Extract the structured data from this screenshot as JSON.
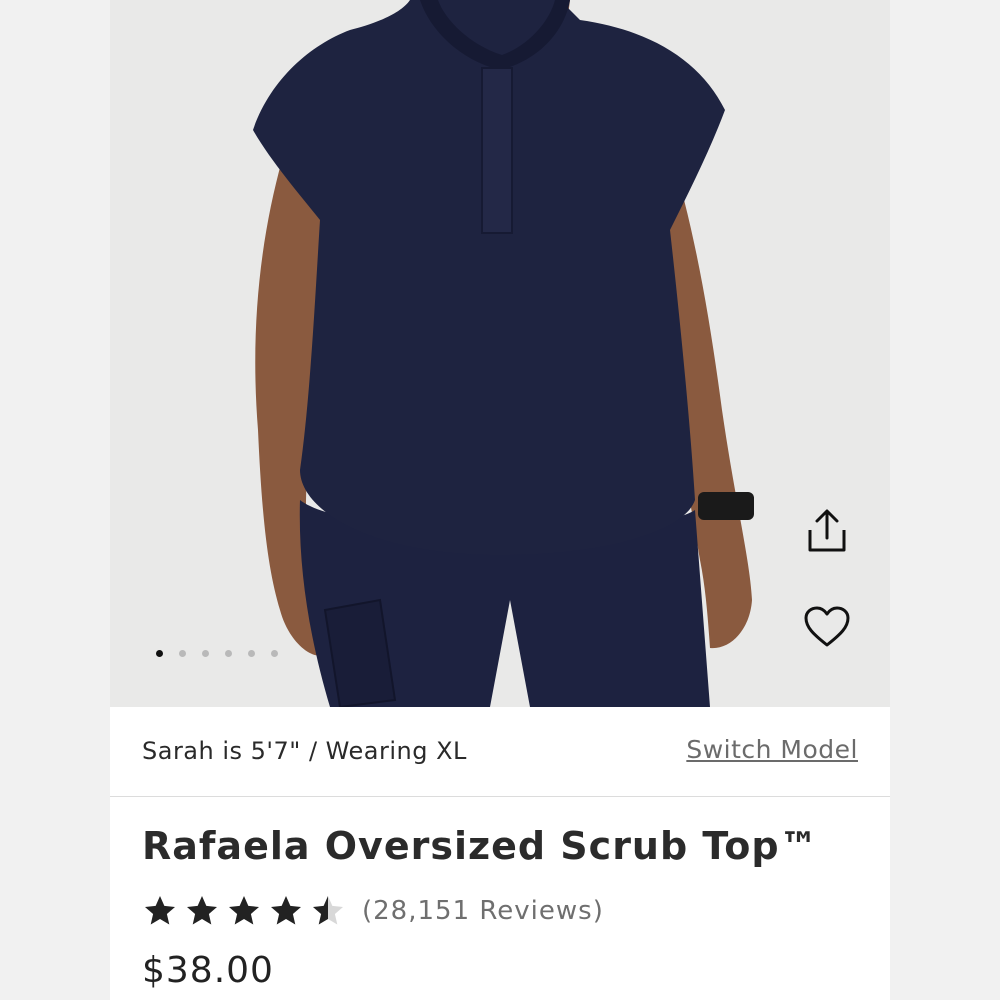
{
  "product": {
    "image_alt": "Model wearing navy oversized scrub top and navy scrub pants",
    "carousel": {
      "total": 6,
      "active_index": 0
    },
    "actions": {
      "share_icon": "share-icon",
      "favorite_icon": "heart-icon"
    },
    "model_info": "Sarah is 5'7\" / Wearing XL",
    "switch_model_label": "Switch Model",
    "title": "Rafaela Oversized Scrub Top™",
    "rating": {
      "value": 4.5,
      "max": 5
    },
    "reviews_text": "(28,151 Reviews)",
    "price": "$38.00"
  },
  "colors": {
    "garment": "#1e2340",
    "skin": "#8a5a3f",
    "background": "#e9e9e8",
    "text": "#2b2b2b"
  }
}
